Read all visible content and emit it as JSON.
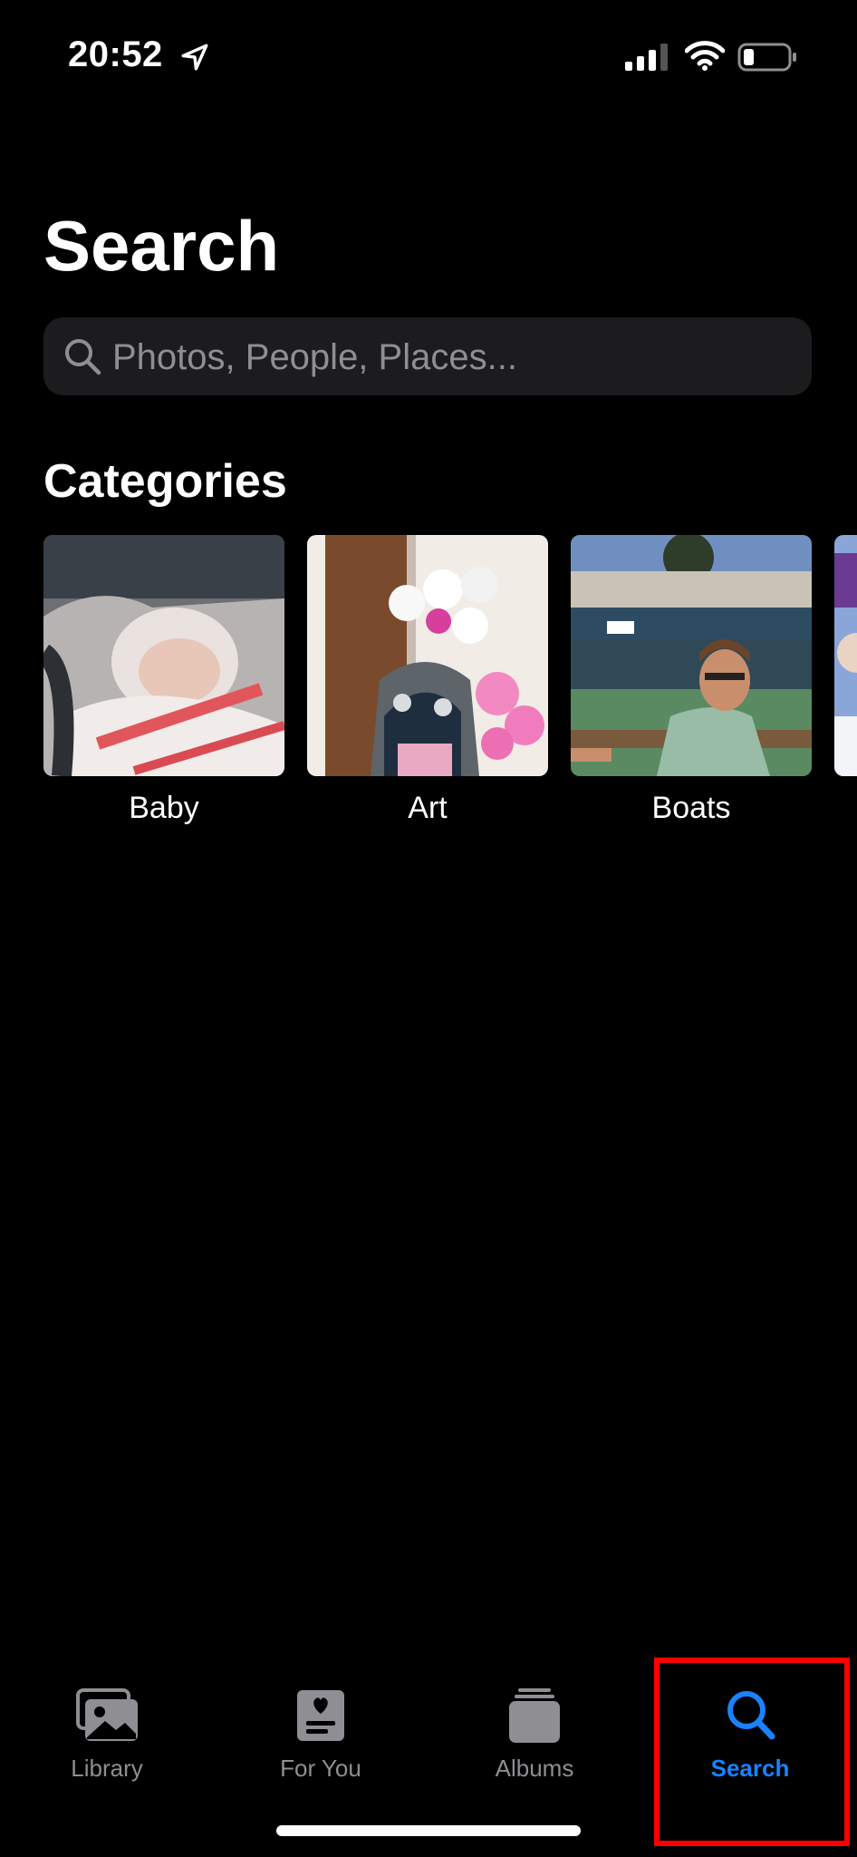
{
  "status_bar": {
    "time": "20:52",
    "icons": [
      "location-arrow-icon",
      "cellular-signal-icon",
      "wifi-icon",
      "battery-icon"
    ]
  },
  "page": {
    "title": "Search"
  },
  "search": {
    "placeholder": "Photos, People, Places...",
    "value": ""
  },
  "categories": {
    "title": "Categories",
    "items": [
      {
        "label": "Baby"
      },
      {
        "label": "Art"
      },
      {
        "label": "Boats"
      }
    ]
  },
  "tab_bar": {
    "items": [
      {
        "label": "Library",
        "icon": "photo-library-icon",
        "active": false
      },
      {
        "label": "For You",
        "icon": "for-you-icon",
        "active": false
      },
      {
        "label": "Albums",
        "icon": "albums-stack-icon",
        "active": false
      },
      {
        "label": "Search",
        "icon": "search-icon",
        "active": true
      }
    ]
  },
  "colors": {
    "background": "#000000",
    "search_field": "#1c1c1e",
    "accent": "#1a82fb",
    "inactive_tab": "#8e8e93",
    "highlight": "#ff0000"
  }
}
